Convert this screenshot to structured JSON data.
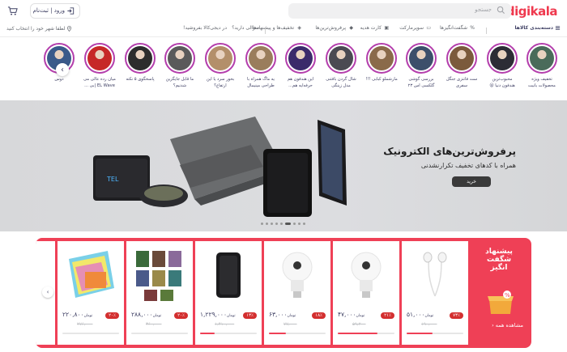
{
  "header": {
    "logo": "digikala",
    "search_placeholder": "جستجو",
    "login_label": "ورود | ثبت‌نام"
  },
  "nav": {
    "categories": "دسته‌بندی کالاها",
    "items": [
      "شگفت‌انگیزها",
      "سوپرمارکت",
      "کارت هدیه",
      "پرفروش‌ترین‌ها",
      "تخفیف‌ها و پیشنهادها",
      "سوالی دارید؟",
      "در دیجی‌کالا بفروشید!"
    ],
    "city": "لطفا شهر خود را انتخاب کنید"
  },
  "stories": [
    {
      "line1": "تخفیف ویژه",
      "line2": "محصولات بانیت",
      "color": "#4a6b5a"
    },
    {
      "line1": "محبوب‌ترین",
      "line2": "هندفون دنیا 😮",
      "color": "#2c2c35"
    },
    {
      "line1": "ست فانتزی جنگل",
      "line2": "سفری",
      "color": "#7b5a3c"
    },
    {
      "line1": "بررسی گوشی",
      "line2": "گلکسی اس ۲۳",
      "color": "#3c4f6b"
    },
    {
      "line1": "مارشملو کبابی !!!",
      "line2": "",
      "color": "#8a6a4a"
    },
    {
      "line1": "شال گردن بافتنی",
      "line2": "مدل زینگی",
      "color": "#4a4a52"
    },
    {
      "line1": "این هندفون هم",
      "line2": "حرفه‌ایه هم...",
      "color": "#3b2a6b"
    },
    {
      "line1": "یه ماگ همراه با",
      "line2": "طراحی مینیمال",
      "color": "#9a7d5c"
    },
    {
      "line1": "بخور سرد یا این",
      "line2": "ارتفاع؟",
      "color": "#b38f6a"
    },
    {
      "line1": "ما قابل جایگزین",
      "line2": "شدنیم؟",
      "color": "#5a5a5a"
    },
    {
      "line1": "پاسخگوی ۵ نکته",
      "line2": "",
      "color": "#2d2d2d"
    },
    {
      "line1": "میان رده عالی می",
      "line2": "EL Wave |بی ...",
      "color": "#c62828"
    },
    {
      "line1": "دوس",
      "line2": "",
      "color": "#3a5a8a"
    }
  ],
  "banner": {
    "title": "پرفروش‌ترین‌های الکترونیک",
    "subtitle": "همراه با کدهای تخفیف تکرارنشدنی",
    "button": "خرید",
    "slide_count": 9,
    "active_slide": 1
  },
  "amazing": {
    "title_lines": [
      "پیشنهاد",
      "شگفت",
      "انگیز"
    ],
    "view_all": "مشاهده همه",
    "products": [
      {
        "discount": "۷۳٪",
        "price": "۵۱,۰۰۰",
        "old": "۱۹۰,۰۰۰",
        "sold": 0.45,
        "kind": "earphone"
      },
      {
        "discount": "۲۱٪",
        "price": "۴۷,۰۰۰",
        "old": "۵۹,۲۰۰",
        "sold": 0.7,
        "kind": "bulb"
      },
      {
        "discount": "۱۸٪",
        "price": "۶۳,۰۰۰",
        "old": "۷۷,۰۰۰",
        "sold": 0.3,
        "kind": "bulb"
      },
      {
        "discount": "۱۳٪",
        "price": "۱,۲۲۹,۰۰۰",
        "old": "۱,۴۱۰,۰۰۰",
        "sold": 0.25,
        "kind": "powerbank"
      },
      {
        "discount": "۲۰٪",
        "price": "۲۸۸,۰۰۰",
        "old": "۳۶۰,۰۰۰",
        "sold": 0.0,
        "kind": "cards"
      },
      {
        "discount": "۲۰٪",
        "price": "۲۲۰,۸۰۰",
        "old": "۲۷۶,۰۰۰",
        "sold": 0.0,
        "kind": "paper"
      },
      {
        "discount": "۱۵٪",
        "price": "",
        "old": "",
        "sold": 0.0,
        "kind": "partial"
      }
    ],
    "currency": "تومان"
  },
  "colors": {
    "brand": "#ef394e",
    "amazing_bg": "#ef4056",
    "story_ring": "#b43eac"
  }
}
